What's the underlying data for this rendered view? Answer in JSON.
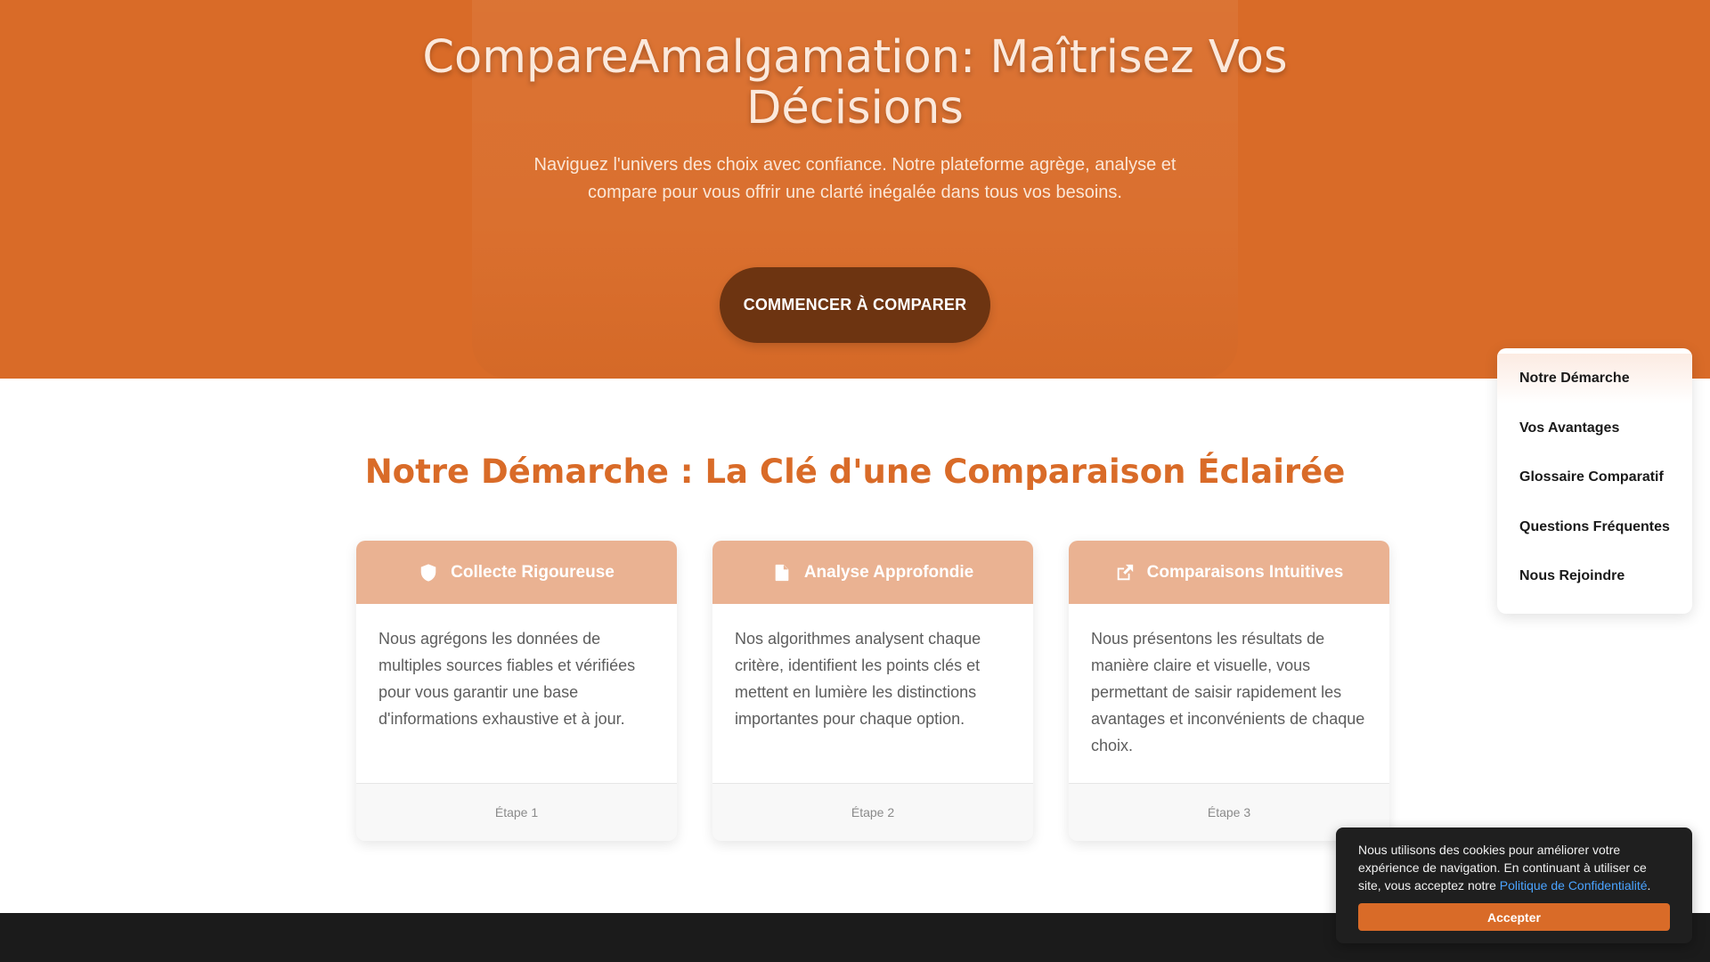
{
  "hero": {
    "title": "CompareAmalgamation: Maîtrisez Vos Décisions",
    "subtitle": "Naviguez l'univers des choix avec confiance. Notre plateforme agrège, analyse et compare pour vous offrir une clarté inégalée dans tous vos besoins.",
    "cta_label": "COMMENCER À COMPARER"
  },
  "process": {
    "title": "Notre Démarche : La Clé d'une Comparaison Éclairée",
    "cards": [
      {
        "icon": "shield-icon",
        "title": "Collecte Rigoureuse",
        "text": "Nous agrégons les données de multiples sources fiables et vérifiées pour vous garantir une base d'informations exhaustive et à jour.",
        "step": "Étape 1"
      },
      {
        "icon": "document-icon",
        "title": "Analyse Approfondie",
        "text": "Nos algorithmes analysent chaque critère, identifient les points clés et mettent en lumière les distinctions importantes pour chaque option.",
        "step": "Étape 2"
      },
      {
        "icon": "external-link-icon",
        "title": "Comparaisons Intuitives",
        "text": "Nous présentons les résultats de manière claire et visuelle, vous permettant de saisir rapidement les avantages et inconvénients de chaque choix.",
        "step": "Étape 3"
      }
    ]
  },
  "side_nav": {
    "items": [
      {
        "label": "Notre Démarche"
      },
      {
        "label": "Vos Avantages"
      },
      {
        "label": "Glossaire Comparatif"
      },
      {
        "label": "Questions Fréquentes"
      },
      {
        "label": "Nous Rejoindre"
      }
    ]
  },
  "cookie": {
    "text": "Nous utilisons des cookies pour améliorer votre expérience de navigation. En continuant à utiliser ce site, vous acceptez notre ",
    "link": "Politique de Confidentialité",
    "suffix": ".",
    "accept_label": "Accepter"
  },
  "colors": {
    "brand": "#d96b28",
    "cta": "#6d3411",
    "card_header": "#eab292",
    "footer": "#1b1b1b"
  }
}
